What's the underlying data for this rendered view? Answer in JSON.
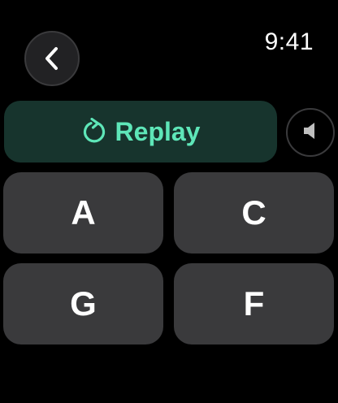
{
  "status_bar": {
    "time": "9:41"
  },
  "navigation": {
    "back_icon": "chevron-left-icon"
  },
  "replay": {
    "label": "Replay",
    "icon": "replay-arrow-icon",
    "accent_color": "#5ee6b8",
    "background_color": "#17342d"
  },
  "speaker": {
    "icon": "speaker-icon"
  },
  "answers": [
    {
      "label": "A"
    },
    {
      "label": "C"
    },
    {
      "label": "G"
    },
    {
      "label": "F"
    }
  ]
}
